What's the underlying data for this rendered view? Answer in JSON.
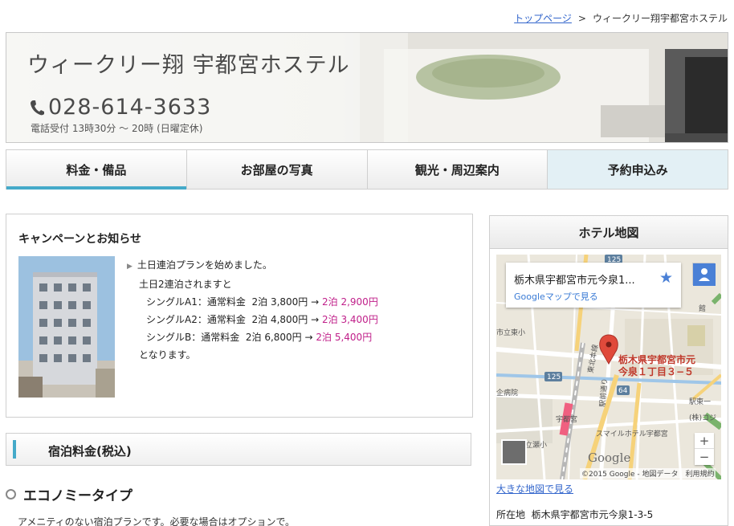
{
  "breadcrumb": {
    "home": "トップページ",
    "separator": ">",
    "current": "ウィークリー翔宇都宮ホステル"
  },
  "header": {
    "title": "ウィークリー翔 宇都宮ホステル",
    "phone": "028-614-3633",
    "hours": "電話受付 13時30分 ～ 20時 (日曜定休)"
  },
  "nav": {
    "items": [
      {
        "label": "料金・備品"
      },
      {
        "label": "お部屋の写真"
      },
      {
        "label": "観光・周辺案内"
      },
      {
        "label": "予約申込み"
      }
    ]
  },
  "news": {
    "title": "キャンペーンとお知らせ",
    "intro": "土日連泊プランを始めました。",
    "line2": "土日2連泊されますと",
    "rates": [
      {
        "label": "シングルA1：通常料金",
        "regular": "2泊 3,800円 →",
        "sale": "2泊 2,900円"
      },
      {
        "label": "シングルA2：通常料金",
        "regular": "2泊 4,800円 →",
        "sale": "2泊 3,400円"
      },
      {
        "label": "シングルB：通常料金",
        "regular": "2泊 6,800円 →",
        "sale": "2泊 5,400円"
      }
    ],
    "outro": "となります。"
  },
  "stay": {
    "title": "宿泊料金(税込)"
  },
  "economy": {
    "title": "エコノミータイプ",
    "desc": "アメニティのない宿泊プランです。必要な場合はオプションで。"
  },
  "map_panel": {
    "title": "ホテル地図",
    "card_address": "栃木県宇都宮市元今泉1...",
    "card_link": "Googleマップで見る",
    "pin_label_1": "栃木県宇都宮市元",
    "pin_label_2": "今泉１丁目３−５",
    "labels": {
      "route_125a": "125",
      "route_125b": "125",
      "route_64": "64",
      "tohoku": "東北本線",
      "utsunomiya": "宇都宮",
      "smile": "スマイルホテル宇都宮",
      "station_east": "駅東一",
      "kojima": "(株)コジ",
      "library": "館",
      "municipal": "市立東小",
      "hospital": "企病院",
      "ritsumei": "立瀬小",
      "stationmae": "駅前通り"
    },
    "google_logo": "Google",
    "attribution": "©2015 Google - 地図データ　利用規約",
    "big_map_link": "大きな地図で見る",
    "location_label": "所在地",
    "location_value": "栃木県宇都宮市元今泉1-3-5"
  },
  "colors": {
    "accent": "#45aac9",
    "sale": "#c0208a",
    "link": "#3366cc"
  }
}
